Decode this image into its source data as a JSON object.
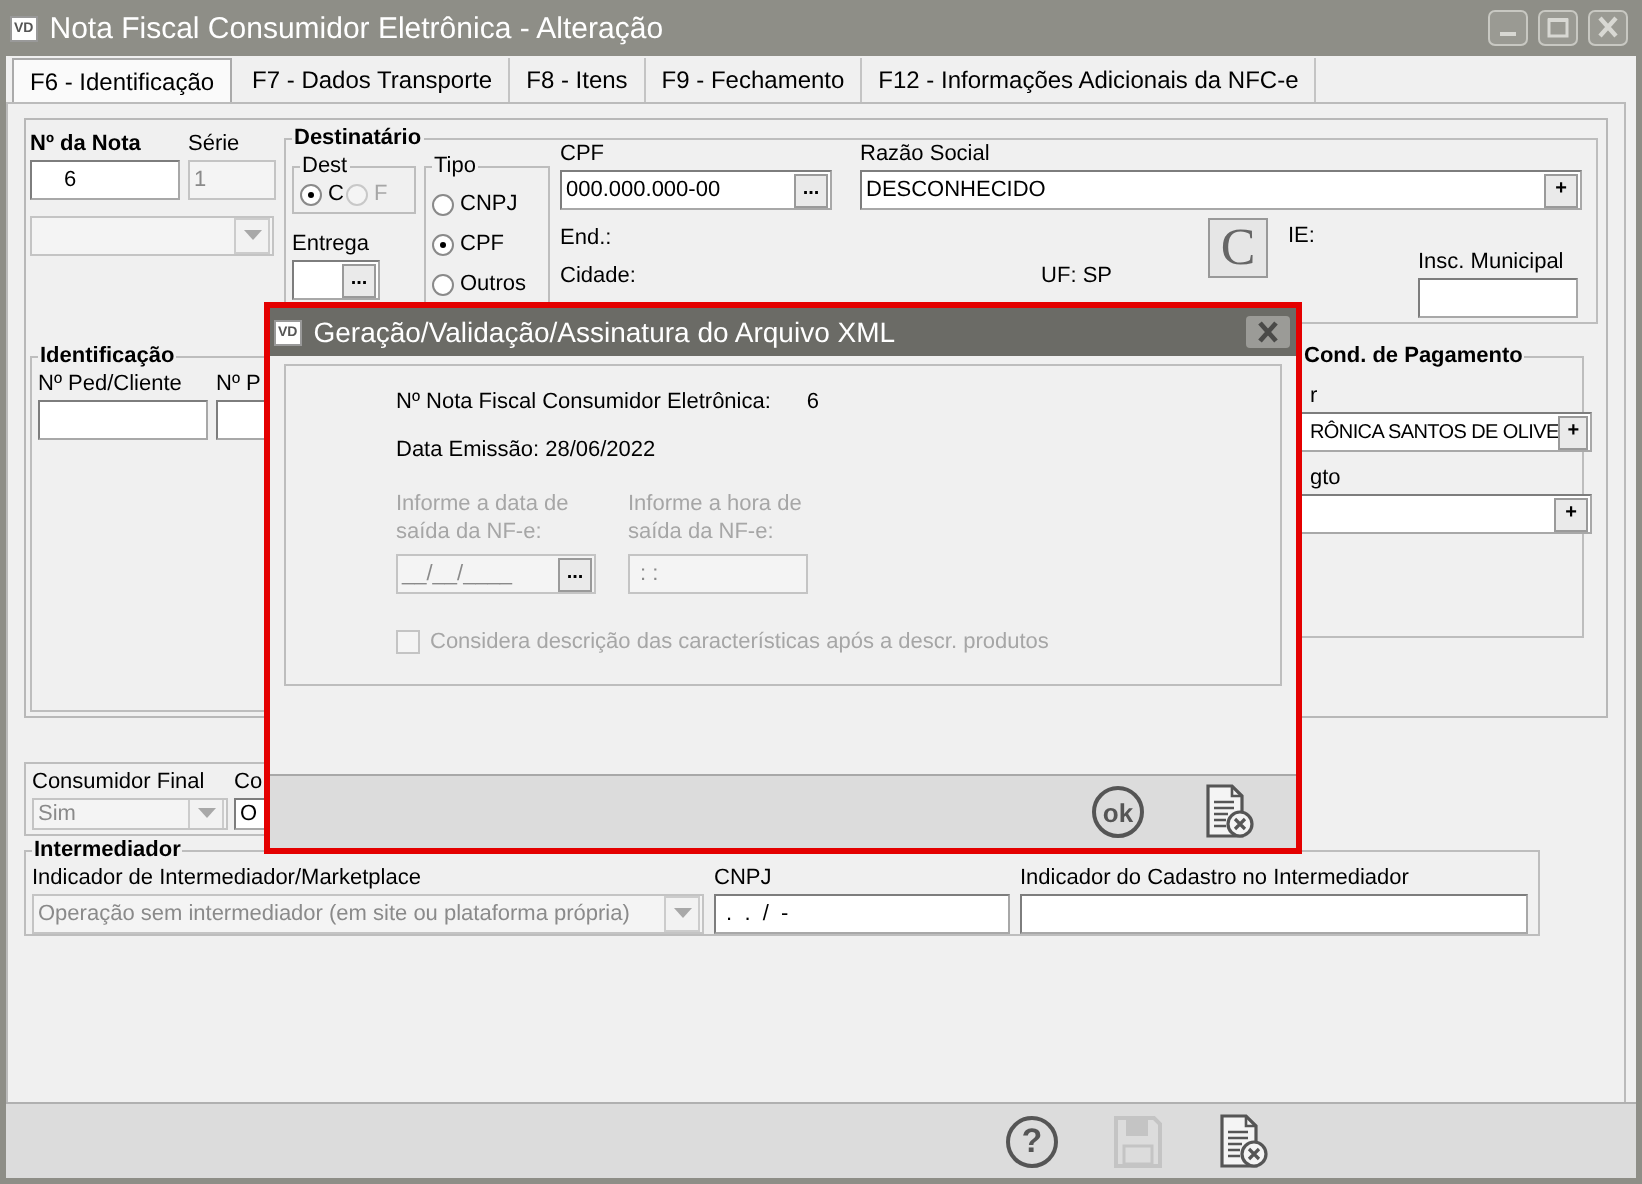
{
  "window": {
    "logo": "VD",
    "title": "Nota Fiscal Consumidor Eletrônica - Alteração"
  },
  "tabs": [
    {
      "label": "F6 - Identificação",
      "selected": true
    },
    {
      "label": "F7 - Dados Transporte",
      "selected": false
    },
    {
      "label": "F8 - Itens",
      "selected": false
    },
    {
      "label": "F9 - Fechamento",
      "selected": false
    },
    {
      "label": "F12 - Informações Adicionais da NFC-e",
      "selected": false
    }
  ],
  "nota": {
    "label": "Nº da Nota",
    "value": "6"
  },
  "serie": {
    "label": "Série",
    "value": "1",
    "disabled": true
  },
  "modelo": {
    "kind": "combo",
    "disabled": true
  },
  "destinatario": {
    "title": "Destinatário",
    "dest": {
      "title": "Dest",
      "options": [
        {
          "label": "C",
          "selected": true,
          "disabled": false
        },
        {
          "label": "F",
          "selected": false,
          "disabled": true
        }
      ]
    },
    "entrega": {
      "label": "Entrega",
      "button": "..."
    },
    "tipo": {
      "title": "Tipo",
      "options": [
        {
          "label": "CNPJ",
          "selected": false,
          "disabled": false
        },
        {
          "label": "CPF",
          "selected": true,
          "disabled": false
        },
        {
          "label": "Outros",
          "selected": false,
          "disabled": false
        }
      ]
    },
    "cpf": {
      "label": "CPF",
      "value": "000.000.000-00",
      "button": "..."
    },
    "razao_social": {
      "label": "Razão Social",
      "value": "DESCONHECIDO",
      "button": "+"
    },
    "endereco": "End.:",
    "cidade": "Cidade:",
    "uf": "UF: SP",
    "c_button": "C",
    "ie": "IE:",
    "insc_municipal": {
      "label": "Insc. Municipal"
    }
  },
  "identificacao": {
    "title": "Identificação",
    "fields": [
      {
        "label": "Nº Ped/Cliente"
      },
      {
        "label": "Nº P"
      }
    ]
  },
  "pagamento": {
    "title": "Cond. de Pagamento",
    "fields": [
      {
        "label": "r",
        "value": "RÔNICA SANTOS DE OLIVE",
        "button": "+"
      },
      {
        "label": "gto",
        "button": "+"
      }
    ]
  },
  "consumidor": [
    {
      "label": "Consumidor Final",
      "kind": "combo",
      "value": "Sim",
      "disabled": true
    },
    {
      "label": "Co",
      "kind": "text",
      "value": "O"
    }
  ],
  "intermediador": {
    "title": "Intermediador",
    "fields": [
      {
        "label": "Indicador de Intermediador/Marketplace",
        "kind": "combo",
        "value": "Operação sem intermediador (em site ou plataforma própria)",
        "disabled": true
      },
      {
        "label": "CNPJ",
        "kind": "text",
        "value": " .  .  /  -"
      },
      {
        "label": "Indicador do Cadastro no Intermediador",
        "kind": "text"
      }
    ]
  },
  "toolbar": [
    {
      "kind": "help",
      "label": "?",
      "disabled": false
    },
    {
      "kind": "save",
      "disabled": true
    },
    {
      "kind": "cancel",
      "disabled": false
    }
  ],
  "dialog": {
    "logo": "VD",
    "title": "Geração/Validação/Assinatura do Arquivo XML",
    "nota_label": "Nº Nota Fiscal Consumidor Eletrônica:",
    "nota_value": "6",
    "data_emissao": "Data Emissão: 28/06/2022",
    "date_field": {
      "label": "Informe a data de saída da NF-e:",
      "value": "__/__/____",
      "button": "...",
      "disabled": true
    },
    "time_field": {
      "label": "Informe a hora de saída da NF-e:",
      "value": " : :",
      "disabled": true
    },
    "checkbox": {
      "label": "Considera descrição das características após a descr. produtos",
      "checked": false,
      "disabled": true
    },
    "buttons": [
      {
        "kind": "ok",
        "label": "ok"
      },
      {
        "kind": "cancel"
      }
    ]
  }
}
